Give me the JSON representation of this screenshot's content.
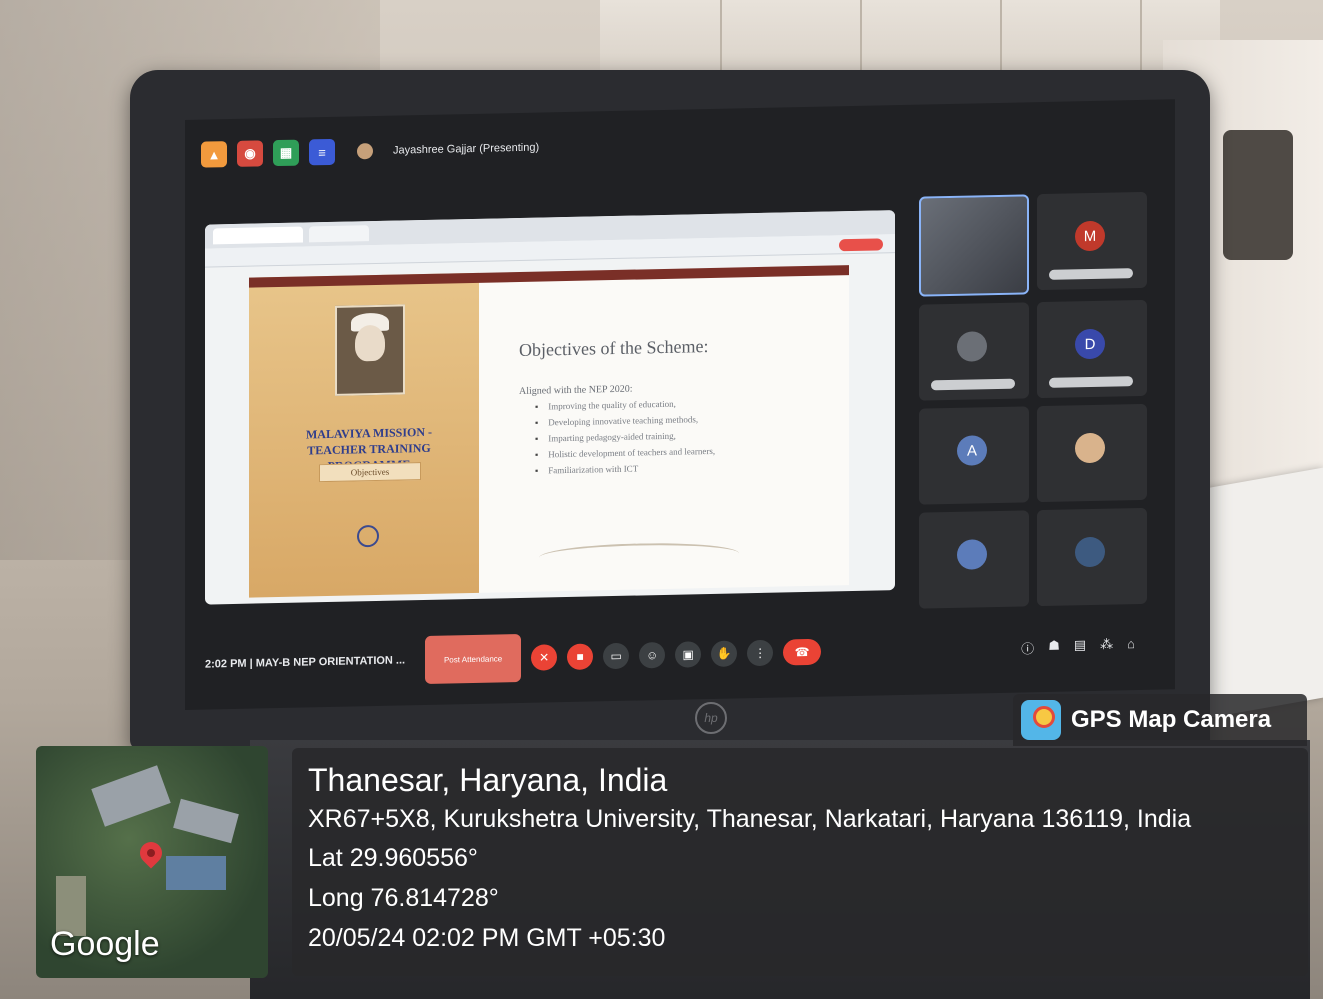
{
  "meet": {
    "presenter": "Jayashree Gajjar (Presenting)",
    "time_title": "2:02 PM  |  MAY-B NEP ORIENTATION ...",
    "attendance_button": "Post Attendance"
  },
  "slide": {
    "program_title": "MALAVIYA MISSION - TEACHER TRAINING PROGRAMME",
    "objectives_label": "Objectives",
    "heading": "Objectives of the Scheme:",
    "subheading": "Aligned with the NEP 2020:",
    "bullets": [
      "Improving the quality of education,",
      "Developing innovative teaching methods,",
      "Imparting pedagogy-aided training,",
      "Holistic development of teachers and learners,",
      "Familiarization with ICT"
    ]
  },
  "participants": {
    "tiles": [
      {
        "letter": "",
        "type": "camera"
      },
      {
        "letter": "M",
        "color": "#c0392b"
      },
      {
        "letter": "",
        "type": "photo"
      },
      {
        "letter": "D",
        "color": "#3949ab"
      },
      {
        "letter": "A",
        "color": "#5c7cba"
      },
      {
        "letter": "",
        "type": "photo"
      },
      {
        "letter": "",
        "type": "others"
      },
      {
        "letter": "",
        "type": "group"
      }
    ]
  },
  "gps": {
    "badge": "GPS Map Camera",
    "place": "Thanesar, Haryana, India",
    "address": "XR67+5X8, Kurukshetra University, Thanesar, Narkatari, Haryana 136119, India",
    "lat": "Lat 29.960556°",
    "long": "Long 76.814728°",
    "datetime": "20/05/24 02:02 PM GMT +05:30",
    "map_brand": "Google"
  },
  "colors": {
    "accent_red": "#ea4335",
    "slide_maroon": "#7a2f27",
    "title_blue": "#2f3d8c"
  }
}
